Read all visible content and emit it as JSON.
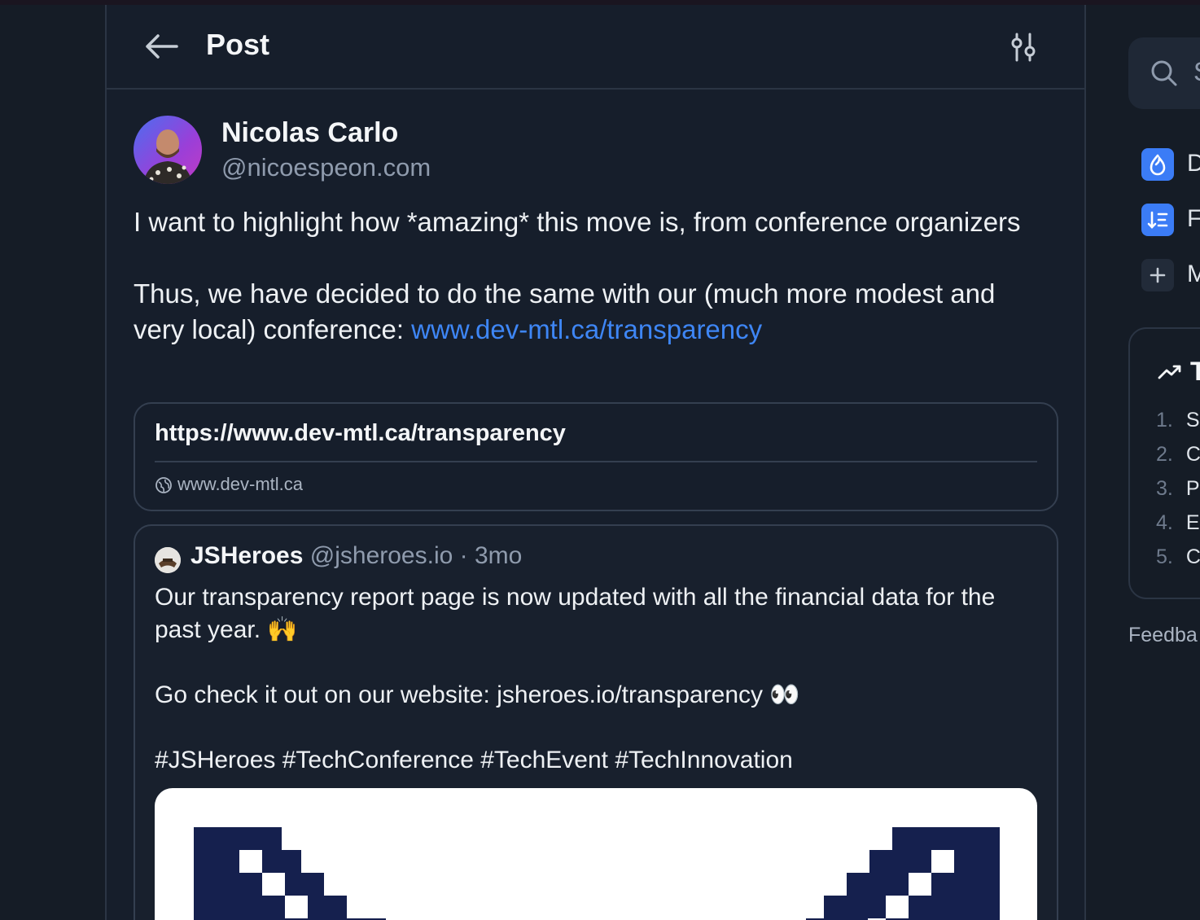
{
  "header": {
    "title": "Post"
  },
  "post": {
    "author_name": "Nicolas Carlo",
    "author_handle": "@nicoespeon.com",
    "text_line1": "I want to highlight how *amazing* this move is, from conference organizers",
    "text_line2_prefix": "Thus, we have decided to do the same with our (much more modest and very local) conference: ",
    "text_link": "www.dev-mtl.ca/transparency",
    "link_card": {
      "url": "https://www.dev-mtl.ca/transparency",
      "domain": "www.dev-mtl.ca"
    },
    "quote": {
      "author_name": "JSHeroes",
      "author_handle": "@jsheroes.io",
      "separator": " · ",
      "time": "3mo",
      "line1": "Our transparency report page is now updated with all the financial data for the past year. 🙌",
      "line2": "Go check it out on our website: jsheroes.io/transparency 👀",
      "line3": "#JSHeroes #TechConference #TechEvent #TechInnovation"
    }
  },
  "sidebar_right": {
    "search_placeholder": "S",
    "nav": [
      {
        "label": "D",
        "icon": "discover-flame-icon"
      },
      {
        "label": "F",
        "icon": "feeds-sort-icon"
      },
      {
        "label": "M",
        "icon": "plus-icon"
      }
    ],
    "trending_title": "T",
    "trending": [
      {
        "num": "1.",
        "label": "S"
      },
      {
        "num": "2.",
        "label": "C"
      },
      {
        "num": "3.",
        "label": "P"
      },
      {
        "num": "4.",
        "label": "E"
      },
      {
        "num": "5.",
        "label": "C"
      }
    ],
    "feedback": "Feedba"
  },
  "colors": {
    "background": "#151c26",
    "panel": "#161e2b",
    "border": "#2b3544",
    "link": "#3e86f5",
    "muted": "#8f9bad",
    "icon_accent": "#3b7cf6"
  }
}
